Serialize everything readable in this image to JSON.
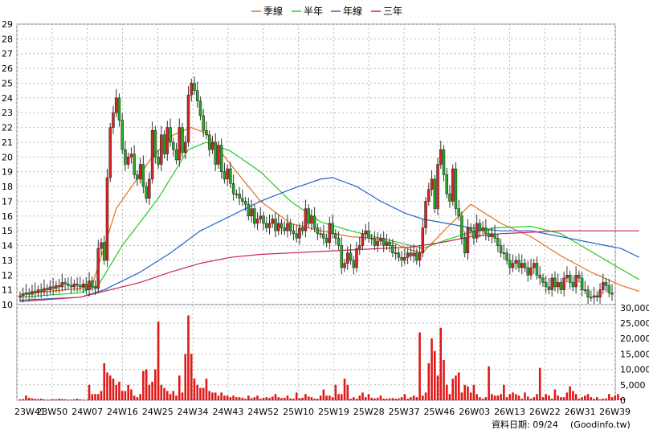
{
  "chart_data": {
    "type": "candlestick",
    "legend": [
      {
        "name": "季線",
        "color": "#e07020"
      },
      {
        "name": "半年",
        "color": "#22cc22"
      },
      {
        "name": "年線",
        "color": "#2266cc"
      },
      {
        "name": "三年",
        "color": "#cc2255"
      }
    ],
    "price_axis": {
      "min": 10,
      "max": 29,
      "ticks": [
        10,
        11,
        12,
        13,
        14,
        15,
        16,
        17,
        18,
        19,
        20,
        21,
        22,
        23,
        24,
        25,
        26,
        27,
        28,
        29
      ]
    },
    "volume_axis": {
      "min": 0,
      "max": 30000,
      "ticks": [
        0,
        5000,
        10000,
        15000,
        20000,
        25000,
        30000
      ],
      "tick_labels": [
        "0",
        "5,000",
        "10,000",
        "15,000",
        "20,000",
        "25,000",
        "30,000"
      ]
    },
    "x_labels": [
      "23W41",
      "23W50",
      "24W07",
      "24W16",
      "24W25",
      "24W34",
      "24W43",
      "24W52",
      "25W10",
      "25W19",
      "25W28",
      "25W37",
      "25W46",
      "26W03",
      "26W13",
      "26W22",
      "26W31",
      "26W39"
    ],
    "closes": [
      10.6,
      10.7,
      10.8,
      10.7,
      10.9,
      10.8,
      11.0,
      10.9,
      11.1,
      11.0,
      11.2,
      11.1,
      11.3,
      11.2,
      11.5,
      11.4,
      11.3,
      11.2,
      11.4,
      11.3,
      11.2,
      11.4,
      11.0,
      11.6,
      11.2,
      11.1,
      13.8,
      14.2,
      13.0,
      18.6,
      22.0,
      23.0,
      24.0,
      22.5,
      20.5,
      19.5,
      20.0,
      20.2,
      18.8,
      18.5,
      19.5,
      18.0,
      17.2,
      18.5,
      21.8,
      20.0,
      19.5,
      21.5,
      20.2,
      22.0,
      21.0,
      20.5,
      19.8,
      22.0,
      20.3,
      21.0,
      24.2,
      25.0,
      24.5,
      23.8,
      22.8,
      21.8,
      21.5,
      20.5,
      21.0,
      19.5,
      20.8,
      19.0,
      18.5,
      19.2,
      18.2,
      17.5,
      17.5,
      17.2,
      17.0,
      16.8,
      16.0,
      16.5,
      15.5,
      15.8,
      16.0,
      15.5,
      15.2,
      15.5,
      15.8,
      15.0,
      15.5,
      15.2,
      15.0,
      15.5,
      15.0,
      14.8,
      14.5,
      15.2,
      15.0,
      16.5,
      15.5,
      16.0,
      15.2,
      14.8,
      14.8,
      14.5,
      14.2,
      15.5,
      14.8,
      14.5,
      14.0,
      12.5,
      12.8,
      13.5,
      13.0,
      12.5,
      13.8,
      14.0,
      14.8,
      15.0,
      14.5,
      14.5,
      14.0,
      14.3,
      14.5,
      14.0,
      14.2,
      14.0,
      13.5,
      13.5,
      13.2,
      13.0,
      13.2,
      13.5,
      13.3,
      13.5,
      13.0,
      13.5,
      15.2,
      17.0,
      17.8,
      18.5,
      16.5,
      19.5,
      20.5,
      18.8,
      17.5,
      17.0,
      19.2,
      16.5,
      16.0,
      14.5,
      13.5,
      15.2,
      15.0,
      14.5,
      15.5,
      15.0,
      15.2,
      14.8,
      14.6,
      14.8,
      14.5,
      14.0,
      13.5,
      13.5,
      13.0,
      12.5,
      12.8,
      13.0,
      12.5,
      12.8,
      12.5,
      12.0,
      12.5,
      12.8,
      12.0,
      11.8,
      11.5,
      11.2,
      11.0,
      11.8,
      11.2,
      11.5,
      11.0,
      11.8,
      12.0,
      11.5,
      11.2,
      12.0,
      11.8,
      11.0,
      11.0,
      10.5,
      10.5,
      10.6,
      10.5,
      11.0,
      11.5,
      11.3,
      10.8,
      10.7
    ],
    "volumes": [
      300,
      400,
      1500,
      800,
      600,
      500,
      400,
      500,
      300,
      200,
      200,
      300,
      300,
      500,
      400,
      300,
      200,
      200,
      300,
      500,
      300,
      200,
      100,
      5000,
      2000,
      2000,
      2000,
      3000,
      12000,
      9000,
      8000,
      7000,
      5000,
      6000,
      3000,
      3000,
      5000,
      3500,
      1500,
      1000,
      2000,
      9500,
      10000,
      5000,
      6000,
      10000,
      25500,
      5000,
      4000,
      3000,
      2000,
      3000,
      1500,
      8000,
      2500,
      15000,
      27500,
      15000,
      7000,
      5000,
      4000,
      4000,
      7000,
      3000,
      2500,
      2500,
      1500,
      2500,
      1500,
      1500,
      1000,
      1500,
      1000,
      1000,
      800,
      500,
      1500,
      700,
      1000,
      1500,
      500,
      800,
      1000,
      800,
      1200,
      2000,
      1000,
      700,
      800,
      1500,
      600,
      500,
      2500,
      700,
      800,
      2000,
      1200,
      1000,
      500,
      500,
      1500,
      3500,
      1500,
      1500,
      1000,
      5000,
      2000,
      2000,
      7000,
      5000,
      500,
      1000,
      500,
      1500,
      2500,
      1000,
      2000,
      800,
      600,
      800,
      1500,
      500,
      500,
      600,
      700,
      500,
      600,
      1000,
      2000,
      500,
      1000,
      1500,
      1000,
      22000,
      1500,
      2500,
      12000,
      20000,
      16000,
      8000,
      23500,
      13000,
      5000,
      2000,
      7000,
      8000,
      9000,
      2500,
      5000,
      4500,
      2500,
      5000,
      2000,
      1000,
      500,
      1000,
      11000,
      2000,
      1500,
      1500,
      2000,
      5000,
      1000,
      2000,
      2500,
      2000,
      1500,
      500,
      2500,
      1200,
      500,
      1000,
      2000,
      10500,
      1000,
      2000,
      1500,
      500,
      3500,
      1500,
      1000,
      1000,
      2500,
      4500,
      3000,
      2000,
      500,
      1000,
      1500,
      2000,
      1000,
      500,
      1000,
      300,
      500,
      600,
      2000,
      1000,
      1500,
      2000,
      700,
      400
    ],
    "ma_quarter": [
      [
        0,
        10.7
      ],
      [
        20,
        11.1
      ],
      [
        24,
        11.3
      ],
      [
        32,
        16.5
      ],
      [
        44,
        20.0
      ],
      [
        51,
        21.5
      ],
      [
        57,
        22.0
      ],
      [
        62,
        21.6
      ],
      [
        70,
        19.5
      ],
      [
        80,
        17.0
      ],
      [
        90,
        15.5
      ],
      [
        100,
        15.0
      ],
      [
        110,
        14.6
      ],
      [
        118,
        14.5
      ],
      [
        125,
        14.1
      ],
      [
        130,
        13.7
      ],
      [
        134,
        13.5
      ],
      [
        142,
        15.2
      ],
      [
        150,
        16.8
      ],
      [
        160,
        15.5
      ],
      [
        170,
        14.6
      ],
      [
        180,
        13.3
      ],
      [
        190,
        12.2
      ],
      [
        200,
        11.3
      ],
      [
        206,
        10.9
      ]
    ],
    "ma_half": [
      [
        0,
        10.5
      ],
      [
        20,
        10.8
      ],
      [
        26,
        11.3
      ],
      [
        34,
        14.0
      ],
      [
        46,
        17.2
      ],
      [
        56,
        20.5
      ],
      [
        62,
        21.0
      ],
      [
        70,
        20.4
      ],
      [
        80,
        19.0
      ],
      [
        90,
        17.0
      ],
      [
        100,
        15.6
      ],
      [
        110,
        15.0
      ],
      [
        120,
        14.5
      ],
      [
        128,
        14.1
      ],
      [
        134,
        13.8
      ],
      [
        142,
        14.4
      ],
      [
        150,
        14.9
      ],
      [
        158,
        15.2
      ],
      [
        170,
        15.3
      ],
      [
        180,
        14.8
      ],
      [
        190,
        13.6
      ],
      [
        200,
        12.4
      ],
      [
        206,
        11.7
      ]
    ],
    "ma_year": [
      [
        0,
        10.3
      ],
      [
        20,
        10.5
      ],
      [
        28,
        11.0
      ],
      [
        40,
        12.2
      ],
      [
        50,
        13.5
      ],
      [
        60,
        15.0
      ],
      [
        70,
        16.0
      ],
      [
        80,
        17.0
      ],
      [
        90,
        17.8
      ],
      [
        100,
        18.5
      ],
      [
        104,
        18.6
      ],
      [
        112,
        18.0
      ],
      [
        120,
        17.0
      ],
      [
        128,
        16.2
      ],
      [
        134,
        15.8
      ],
      [
        142,
        15.5
      ],
      [
        150,
        15.2
      ],
      [
        160,
        15.0
      ],
      [
        170,
        15.0
      ],
      [
        180,
        14.6
      ],
      [
        190,
        14.2
      ],
      [
        200,
        13.8
      ],
      [
        206,
        13.2
      ]
    ],
    "ma_3year": [
      [
        0,
        10.2
      ],
      [
        20,
        10.5
      ],
      [
        30,
        11.0
      ],
      [
        40,
        11.5
      ],
      [
        50,
        12.2
      ],
      [
        60,
        12.8
      ],
      [
        70,
        13.2
      ],
      [
        80,
        13.4
      ],
      [
        90,
        13.5
      ],
      [
        100,
        13.6
      ],
      [
        110,
        13.7
      ],
      [
        120,
        13.8
      ],
      [
        130,
        13.9
      ],
      [
        140,
        14.2
      ],
      [
        150,
        14.6
      ],
      [
        160,
        14.8
      ],
      [
        170,
        14.9
      ],
      [
        180,
        15.0
      ],
      [
        190,
        15.0
      ],
      [
        206,
        15.0
      ]
    ]
  },
  "footer": {
    "date_text": "資料日期: 09/24",
    "source_text": "(Goodinfo.tw)"
  }
}
